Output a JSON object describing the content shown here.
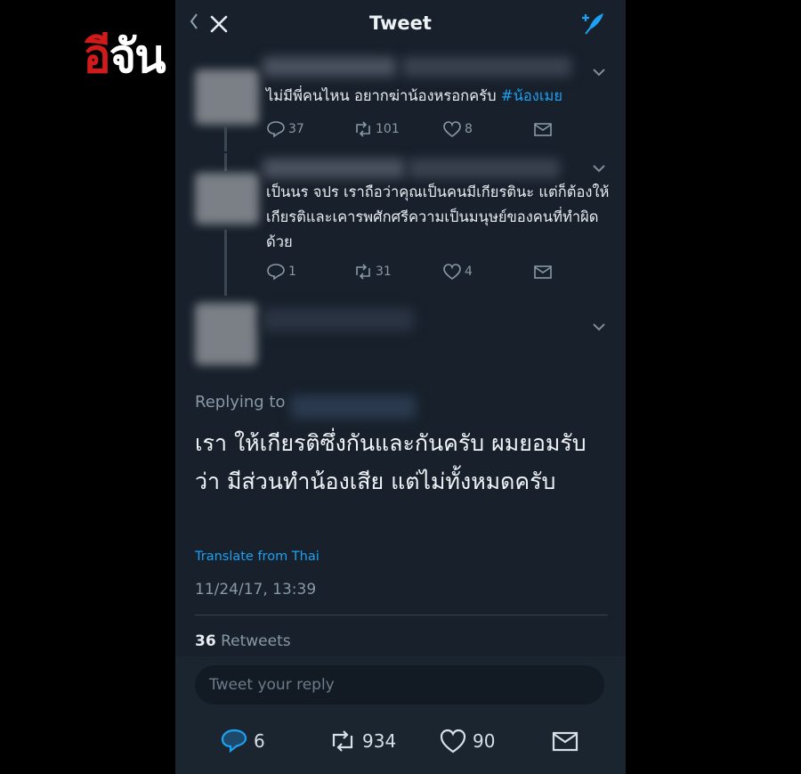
{
  "watermark": {
    "text_a": "อี",
    "text_b": "จัน"
  },
  "header": {
    "title": "Tweet",
    "close_icon": "close-icon",
    "compose_icon": "compose-feather-icon"
  },
  "context_tweets": [
    {
      "text": "ไม่มีพี่คนไหน อยากฆ่าน้องหรอกครับ ",
      "hashtag": "#น้องเมย",
      "replies": "37",
      "retweets": "101",
      "likes": "8"
    },
    {
      "text": "เป็นนร จปร เราถือว่าคุณเป็นคนมีเกียรตินะ แต่ก็ต้องให้เกียรติและเคารพศักศรีความเป็นมนุษย์ของคนที่ทำผิดด้วย",
      "replies": "1",
      "retweets": "31",
      "likes": "4"
    }
  ],
  "main_tweet": {
    "replying_label": "Replying to",
    "text": "เรา ให้เกียรติซึ่งกันและกันครับ ผมยอมรับว่า มีส่วนทำน้องเสีย แต่ไม่ทั้งหมดครับ",
    "translate_label": "Translate from Thai",
    "timestamp": "11/24/17, 13:39",
    "retweets_count": "36",
    "retweets_label": "Retweets"
  },
  "reply_box": {
    "placeholder": "Tweet your reply"
  },
  "bottom_actions": {
    "replies": "6",
    "retweets": "934",
    "likes": "90"
  },
  "colors": {
    "background": "#17202b",
    "accent": "#1da1f2",
    "muted": "#8899a6"
  }
}
